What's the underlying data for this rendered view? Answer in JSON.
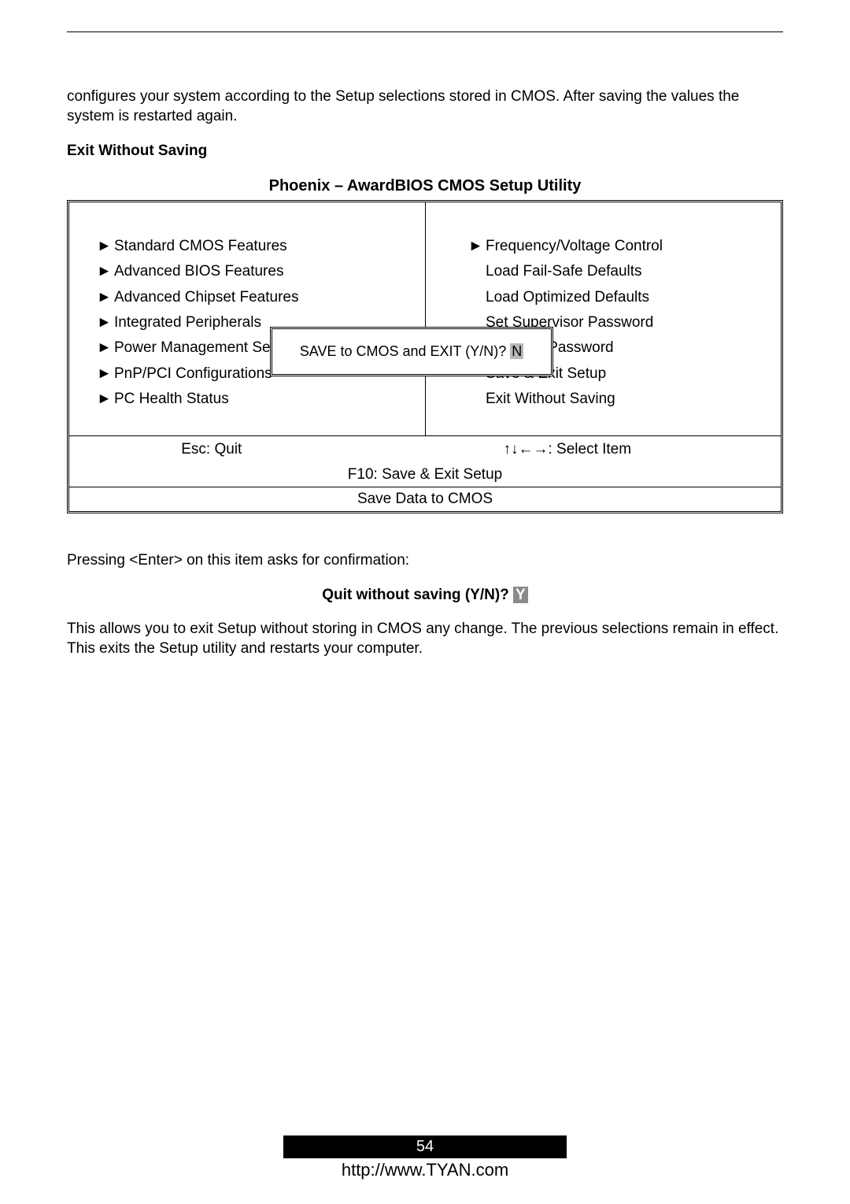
{
  "intro": "configures your system according to the Setup selections stored in CMOS. After saving the values the system is restarted again.",
  "section_heading": "Exit Without Saving",
  "bios_title": "Phoenix – AwardBIOS CMOS Setup Utility",
  "menu": {
    "left": [
      "Standard CMOS Features",
      "Advanced BIOS Features",
      "Advanced Chipset Features",
      "Integrated Peripherals",
      "Power Management Setup",
      "PnP/PCI Configurations",
      "PC Health Status"
    ],
    "right_first": "Frequency/Voltage Control",
    "right_rest": [
      "Load Fail-Safe Defaults",
      "Load Optimized Defaults",
      "Set Supervisor Password",
      "Set User Password",
      "Save & Exit Setup",
      "Exit Without Saving"
    ]
  },
  "popup": {
    "text": "SAVE to CMOS and EXIT (Y/N)? ",
    "answer": "N"
  },
  "keys": {
    "esc": "Esc:  Quit",
    "arrows": "↑↓←→: Select Item",
    "f10": "F10:  Save & Exit Setup",
    "save": "Save Data to CMOS"
  },
  "after1": "Pressing <Enter> on this item asks for confirmation:",
  "quit_prompt": "Quit without saving (Y/N)?  ",
  "quit_answer": "Y",
  "after2": "This allows you to exit Setup without storing in CMOS any change.  The previous selections remain in effect.  This exits the Setup utility and restarts your computer.",
  "page_number": "54",
  "footer_url": "http://www.TYAN.com"
}
